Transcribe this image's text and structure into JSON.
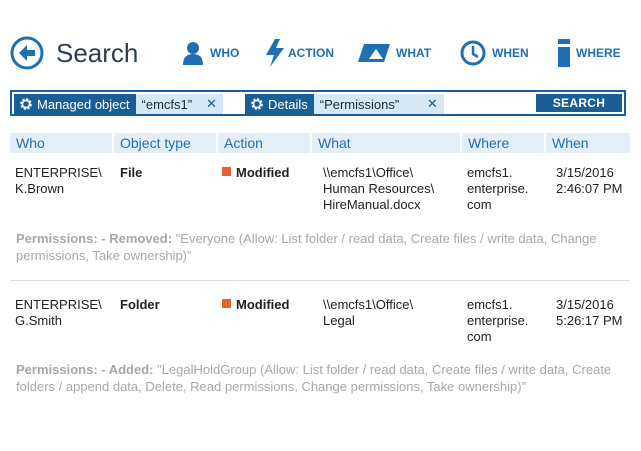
{
  "header": {
    "title": "Search",
    "nav": [
      {
        "label": "WHO",
        "icon": "user-icon"
      },
      {
        "label": "ACTION",
        "icon": "lightning-icon"
      },
      {
        "label": "WHAT",
        "icon": "file-type-icon"
      },
      {
        "label": "WHEN",
        "icon": "clock-icon"
      },
      {
        "label": "WHERE",
        "icon": "server-icon"
      }
    ]
  },
  "search": {
    "chips": [
      {
        "field": "Managed object",
        "value": "“emcfs1”",
        "remove": "✕"
      },
      {
        "field": "Details",
        "value": "“Permissions”",
        "remove": "✕"
      }
    ],
    "button_label": "SEARCH"
  },
  "table": {
    "columns": [
      "Who",
      "Object type",
      "Action",
      "What",
      "Where",
      "When"
    ],
    "rows": [
      {
        "who": "ENTERPRISE\\\nK.Brown",
        "object_type": "File",
        "action": "Modified",
        "what": "\\\\emcfs1\\Office\\\nHuman Resources\\\nHireManual.docx",
        "where": "emcfs1.\nenterprise.\ncom",
        "when": "3/15/2016\n2:46:07 PM",
        "detail_label": "Permissions: - Removed:",
        "detail_text": " \"Everyone (Allow: List folder / read data, Create files / write data, Change permissions, Take ownership)”"
      },
      {
        "who": "ENTERPRISE\\\nG.Smith",
        "object_type": "Folder",
        "action": "Modified",
        "what": "\\\\emcfs1\\Office\\\nLegal",
        "where": "emcfs1.\nenterprise.\ncom",
        "when": "3/15/2016\n5:26:17 PM",
        "detail_label": "Permissions: - Added:",
        "detail_text": " \"LegalHoldGroup (Allow: List folder / read data, Create files / write data, Create folders / append data, Delete, Read permissions, Change permissions, Take ownership)”"
      }
    ]
  },
  "colors": {
    "brand_blue": "#1a5e96",
    "header_blue": "#1f6fb5",
    "modified_orange": "#e8622c",
    "detail_gray": "#a7a7a7"
  }
}
